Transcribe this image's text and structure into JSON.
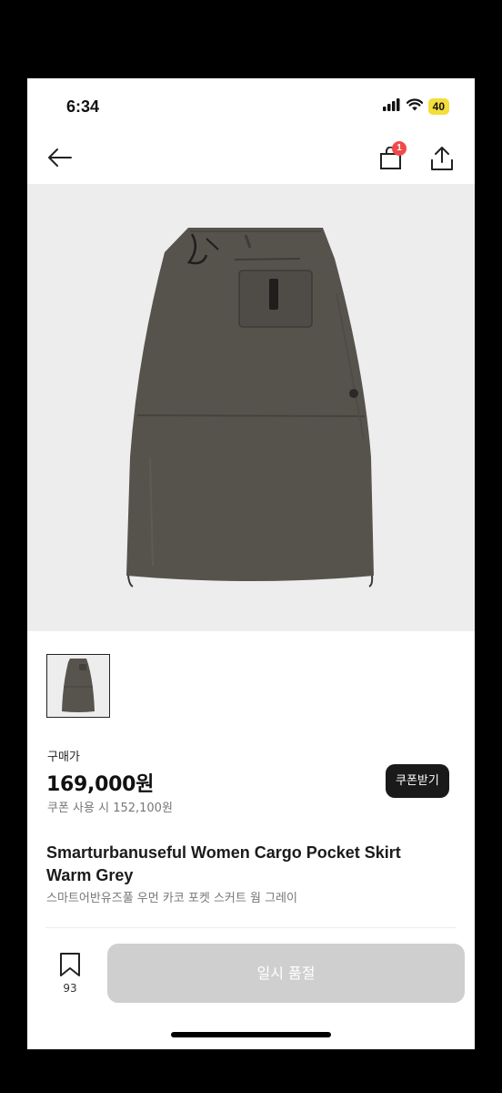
{
  "status_bar": {
    "time": "6:34",
    "battery": "40"
  },
  "nav": {
    "cart_badge": "1"
  },
  "product": {
    "price_label": "구매가",
    "price": "169,000원",
    "coupon_price": "쿠폰 사용 시 152,100원",
    "coupon_button": "쿠폰받기",
    "title_en": "Smarturbanuseful Women Cargo Pocket Skirt Warm Grey",
    "title_ko": "스마트어반유즈풀 우먼 카코 포켓 스커트 웜 그레이"
  },
  "bottom_bar": {
    "wish_count": "93",
    "buy_button": "일시 품절"
  },
  "colors": {
    "skirt": "#56534d",
    "button_disabled": "#cfcfcf",
    "badge": "#f04a4a",
    "battery": "#f5dd3a"
  },
  "icons": [
    "back-arrow-icon",
    "shopping-bag-icon",
    "share-icon",
    "bookmark-icon",
    "signal-icon",
    "wifi-icon"
  ]
}
